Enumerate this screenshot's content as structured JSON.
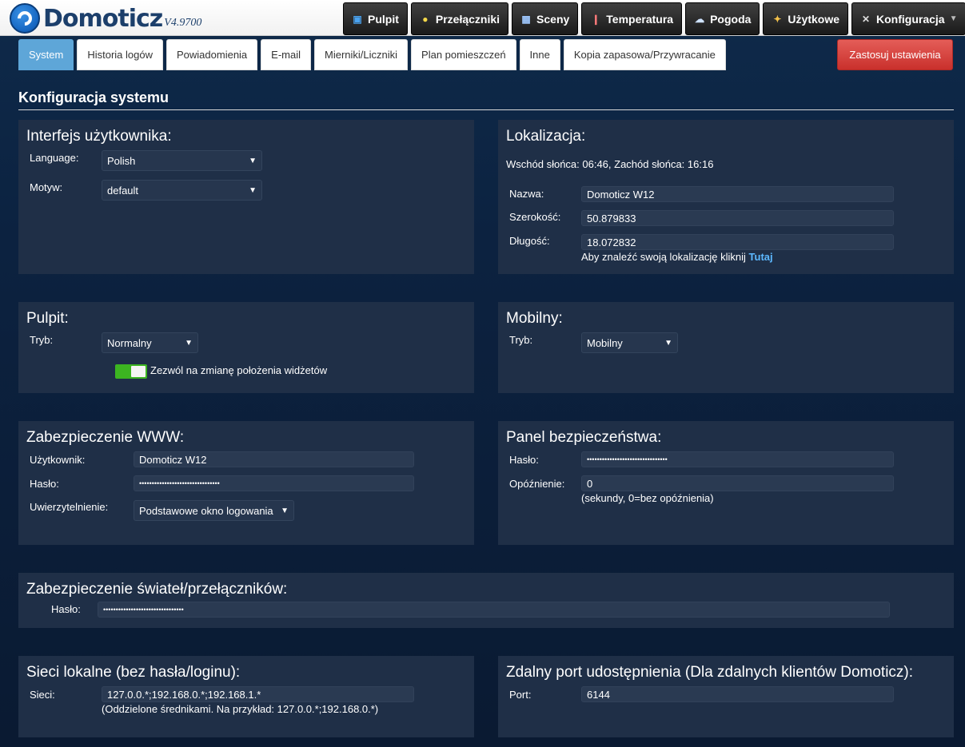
{
  "app": {
    "logo_text": "Domoticz",
    "version": "V4.9700"
  },
  "nav": [
    {
      "label": "Pulpit",
      "icon": "dashboard-icon"
    },
    {
      "label": "Przełączniki",
      "icon": "bulb-icon"
    },
    {
      "label": "Sceny",
      "icon": "scene-icon"
    },
    {
      "label": "Temperatura",
      "icon": "thermometer-icon"
    },
    {
      "label": "Pogoda",
      "icon": "weather-icon"
    },
    {
      "label": "Użytkowe",
      "icon": "utility-icon"
    },
    {
      "label": "Konfiguracja",
      "icon": "tools-icon"
    }
  ],
  "tabs": [
    {
      "label": "System",
      "active": true
    },
    {
      "label": "Historia logów"
    },
    {
      "label": "Powiadomienia"
    },
    {
      "label": "E-mail"
    },
    {
      "label": "Mierniki/Liczniki"
    },
    {
      "label": "Plan pomieszczeń"
    },
    {
      "label": "Inne"
    },
    {
      "label": "Kopia zapasowa/Przywracanie"
    }
  ],
  "apply_label": "Zastosuj ustawienia",
  "page_title": "Konfiguracja systemu",
  "ui": {
    "title": "Interfejs użytkownika:",
    "language_label": "Language:",
    "language_value": "Polish",
    "theme_label": "Motyw:",
    "theme_value": "default"
  },
  "location": {
    "title": "Lokalizacja:",
    "sun": "Wschód słońca: 06:46, Zachód słońca: 16:16",
    "name_label": "Nazwa:",
    "name_value": "Domoticz W12",
    "lat_label": "Szerokość:",
    "lat_value": "50.879833",
    "lon_label": "Długość:",
    "lon_value": "18.072832",
    "hint": "Aby znaleźć swoją lokalizację kliknij",
    "hint_link": "Tutaj"
  },
  "dashboard": {
    "title": "Pulpit:",
    "mode_label": "Tryb:",
    "mode_value": "Normalny",
    "toggle_label": "Zezwól na zmianę położenia widżetów",
    "toggle_on": true
  },
  "mobile": {
    "title": "Mobilny:",
    "mode_label": "Tryb:",
    "mode_value": "Mobilny"
  },
  "www": {
    "title": "Zabezpieczenie WWW:",
    "user_label": "Użytkownik:",
    "user_value": "Domoticz W12",
    "pass_label": "Hasło:",
    "pass_value": "••••••••••••••••••••••••••••••••",
    "auth_label": "Uwierzytelnienie:",
    "auth_value": "Podstawowe okno logowania"
  },
  "security_panel": {
    "title": "Panel bezpieczeństwa:",
    "pass_label": "Hasło:",
    "pass_value": "••••••••••••••••••••••••••••••••",
    "delay_label": "Opóźnienie:",
    "delay_value": "0",
    "delay_note": "(sekundy, 0=bez opóźnienia)"
  },
  "lights": {
    "title": "Zabezpieczenie świateł/przełączników:",
    "pass_label": "Hasło:",
    "pass_value": "••••••••••••••••••••••••••••••••"
  },
  "local_nets": {
    "title": "Sieci lokalne (bez hasła/loginu):",
    "nets_label": "Sieci:",
    "nets_value": "127.0.0.*;192.168.0.*;192.168.1.*",
    "nets_note": "(Oddzielone średnikami. Na przykład: 127.0.0.*;192.168.0.*)"
  },
  "remote": {
    "title": "Zdalny port udostępnienia (Dla zdalnych klientów Domoticz):",
    "port_label": "Port:",
    "port_value": "6144"
  }
}
